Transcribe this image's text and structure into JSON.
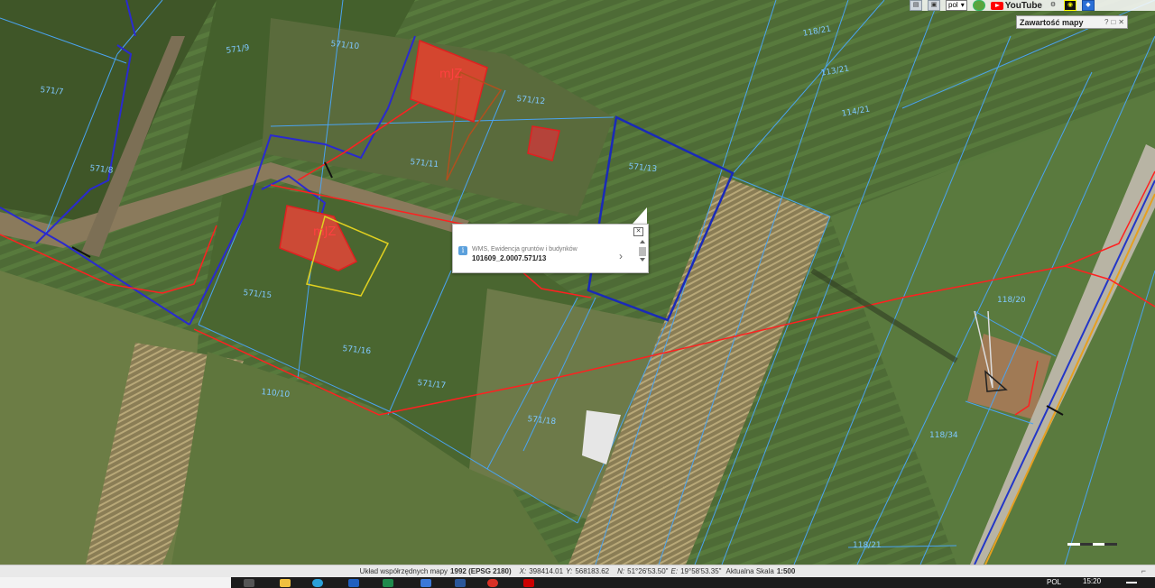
{
  "toolbar": {
    "language_value": "pol",
    "youtube_label": "YouTube",
    "icons": [
      "print-icon",
      "save-icon",
      "language-select",
      "extension-icon",
      "youtube-logo",
      "gear-icon",
      "dark-mode-icon",
      "bookmark-icon"
    ]
  },
  "map_panel": {
    "title": "Zawartość mapy",
    "help": "?",
    "minimize": "□",
    "close": "✕"
  },
  "popup": {
    "source": "WMS, Ewidencja gruntów i budynków",
    "parcel_id": "101609_2.0007.571/13",
    "close": "✕",
    "next": "›"
  },
  "parcels": {
    "p_571_9": "571/9",
    "p_571_10": "571/10",
    "p_571_12": "571/12",
    "p_571_11": "571/11",
    "p_571_13": "571/13",
    "p_571_16": "571/16",
    "p_571_15": "571/15",
    "p_571_17": "571/17",
    "p_571_18": "571/18",
    "p_571_7": "571/7",
    "p_571_8": "571/8",
    "p_118_21_a": "118/21",
    "p_113_21": "113/21",
    "p_114_21": "114/21",
    "p_118_20": "118/20",
    "p_118_34": "118/34",
    "p_118_21_b": "118/21",
    "p_110_10": "110/10"
  },
  "buildings": {
    "b1": "mJZ",
    "b2": "mJZ"
  },
  "statusbar": {
    "crs_prefix": "Układ współrzędnych mapy",
    "crs_value": "1992 (EPSG 2180)",
    "x_label": "X:",
    "x_value": "398414.01",
    "y_label": "Y:",
    "y_value": "568183.62",
    "n_label": "N:",
    "n_value": "51°26'53.50\"",
    "e_label": "E:",
    "e_value": "19°58'53.35\"",
    "scale_label": "Aktualna Skala",
    "scale_value": "1:500"
  },
  "taskbar": {
    "language": "POL",
    "time": "15:20"
  },
  "colors": {
    "parcel_line": "#4aa3f0",
    "selected_parcel": "#1a2ab8",
    "utility_line": "#ff2020",
    "building": "#e02020",
    "field": "#4f6a37"
  }
}
